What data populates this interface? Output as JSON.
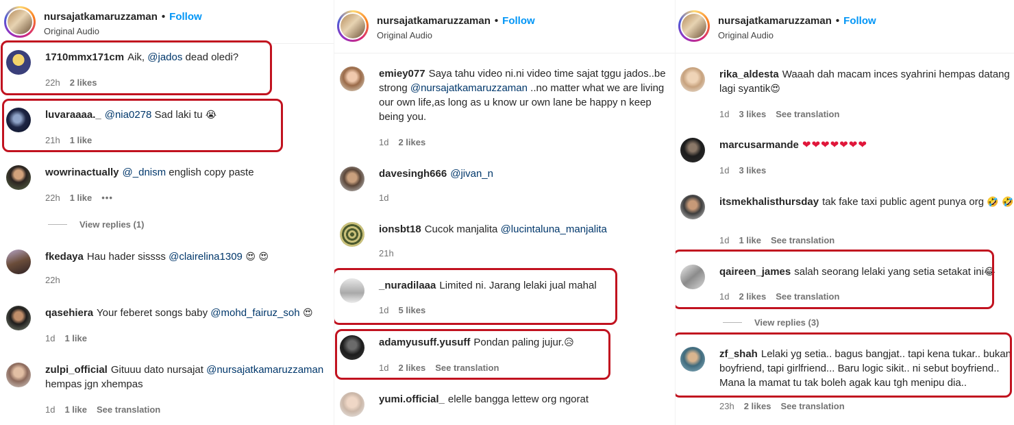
{
  "header": {
    "username": "nursajatkamaruzzaman",
    "dot": "•",
    "follow": "Follow",
    "audio": "Original Audio"
  },
  "colors": {
    "follow": "#0095f6",
    "mention": "#00376b",
    "highlight": "#c1121f"
  },
  "icons": {
    "more": "more-horizontal-icon"
  },
  "panel0": [
    {
      "user": "1710mmx171cm",
      "pre": "Aik, ",
      "mention": "@jados",
      "post": " dead oledi?",
      "time": "22h",
      "likes": "2 likes"
    },
    {
      "user": "luvaraaaa._",
      "mention": "@nia0278",
      "post": " Sad laki tu ",
      "emoji": "😭",
      "time": "21h",
      "likes": "1 like"
    },
    {
      "user": "wowrinactually",
      "mention": "@_dnism",
      "post": " english copy paste",
      "time": "22h",
      "likes": "1 like",
      "more": "•••",
      "replies": "View replies (1)"
    },
    {
      "user": "fkedaya",
      "pre": "Hau hader sissss ",
      "mention": "@clairelina1309",
      "emoji": " 😍 😍",
      "time": "22h"
    },
    {
      "user": "qasehiera",
      "pre": "Your feberet songs baby ",
      "mention": "@mohd_fairuz_soh",
      "emoji": " 😍",
      "time": "1d",
      "likes": "1 like"
    },
    {
      "user": "zulpi_official",
      "pre": "Gituuu dato nursajat ",
      "mention": "@nursajatkamaruzzaman",
      "post": " hempas jgn xhempas",
      "time": "1d",
      "likes": "1 like",
      "translate": "See translation"
    }
  ],
  "panel1": [
    {
      "user": "emiey077",
      "pre": "Saya tahu video ni.ni video time sajat tggu jados..be strong ",
      "mention": "@nursajatkamaruzzaman",
      "post": " ..no matter what we are living our own life,as long as u know ur own lane be happy n keep being you.",
      "time": "1d",
      "likes": "2 likes"
    },
    {
      "user": "davesingh666",
      "mention": "@jivan_n",
      "time": "1d"
    },
    {
      "user": "ionsbt18",
      "pre": "Cucok manjalita ",
      "mention": "@lucintaluna_manjalita",
      "time": "21h"
    },
    {
      "user": "_nuradilaaa",
      "pre": "Limited ni. Jarang lelaki jual mahal",
      "time": "1d",
      "likes": "5 likes"
    },
    {
      "user": "adamyusuff.yusuff",
      "pre": "Pondan paling jujur.",
      "emoji": "😥",
      "time": "1d",
      "likes": "2 likes",
      "translate": "See translation"
    },
    {
      "user": "yumi.official_",
      "pre": "elelle bangga lettew org ngorat"
    }
  ],
  "panel2": [
    {
      "user": "rika_aldesta",
      "pre": "Waaah dah macam inces syahrini hempas datang lagi syantik",
      "emoji": "😍",
      "time": "1d",
      "likes": "3 likes",
      "translate": "See translation"
    },
    {
      "user": "marcusarmande",
      "hearts": "❤❤❤❤❤❤❤",
      "time": "1d",
      "likes": "3 likes"
    },
    {
      "user": "itsmekhalisthursday",
      "pre": "tak fake taxi public agent punya org ",
      "emoji": "🤣 🤣",
      "time": "1d",
      "likes": "1 like",
      "translate": "See translation"
    },
    {
      "user": "qaireen_james",
      "pre": "salah seorang lelaki yang setia setakat ini",
      "emoji": "😂",
      "time": "1d",
      "likes": "2 likes",
      "translate": "See translation",
      "replies": "View replies (3)"
    },
    {
      "user": "zf_shah",
      "pre": "Lelaki yg setia.. bagus bangjat.. tapi kena tukar.. bukan boyfriend, tapi girlfriend... Baru logic sikit.. ni sebut boyfriend.. Mana la mamat tu tak boleh agak kau tgh menipu dia..",
      "time": "23h",
      "likes": "2 likes",
      "translate": "See translation"
    }
  ]
}
